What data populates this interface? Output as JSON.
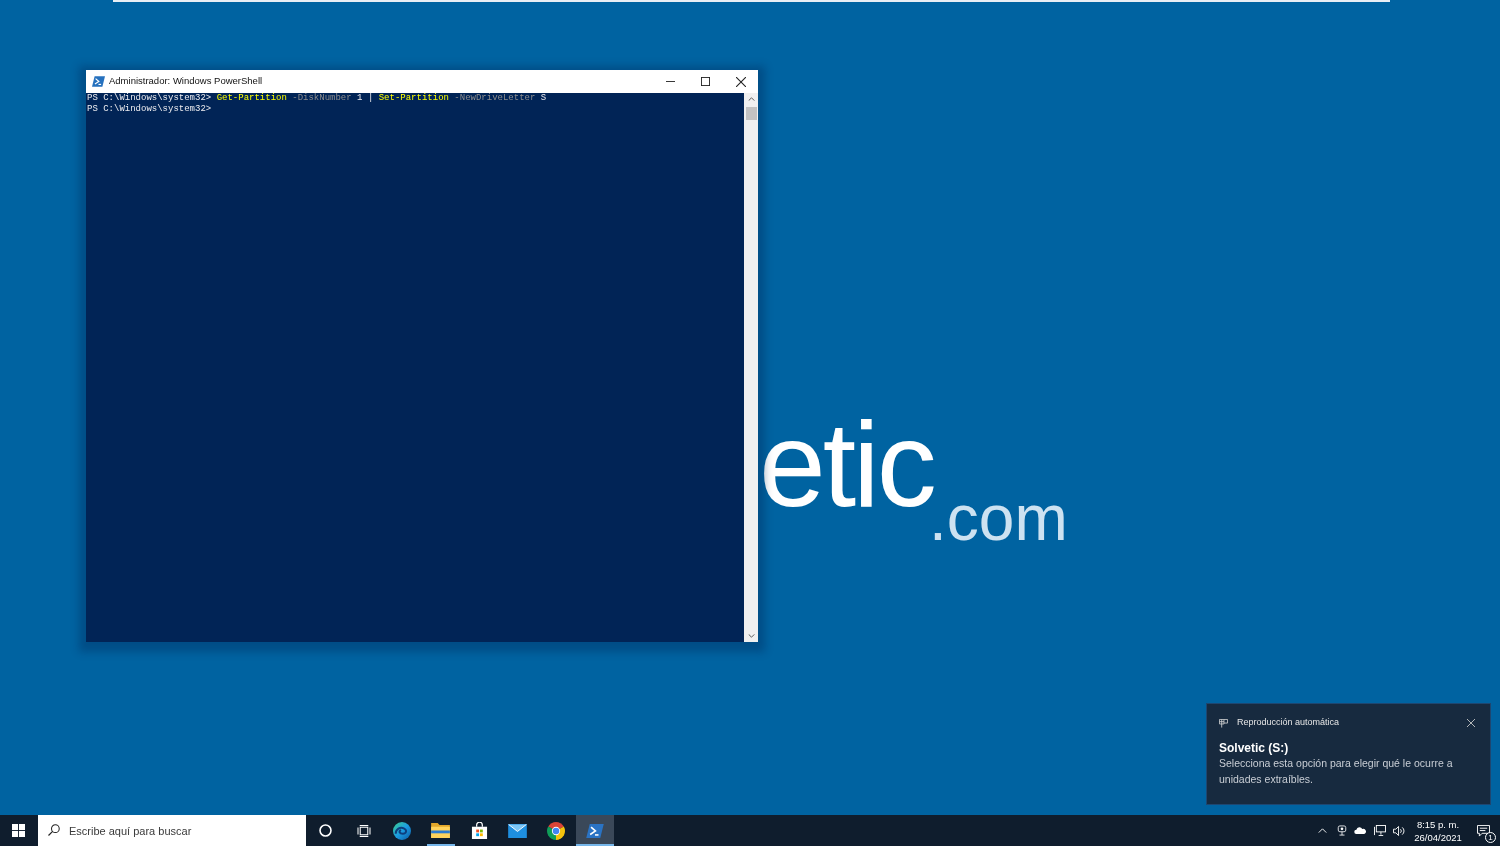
{
  "desktop": {
    "wallpaper_logo": {
      "text": "etic",
      "suffix": ".com"
    }
  },
  "window": {
    "title": "Administrador: Windows PowerShell",
    "console_lines": [
      {
        "segments": [
          {
            "kind": "prompt",
            "text": "PS C:\\Windows\\system32>"
          },
          {
            "kind": "command",
            "text": "Get-Partition"
          },
          {
            "kind": "parameter",
            "text": "-DiskNumber"
          },
          {
            "kind": "argument",
            "text": "1"
          },
          {
            "kind": "operator",
            "text": "|"
          },
          {
            "kind": "command",
            "text": "Set-Partition"
          },
          {
            "kind": "parameter",
            "text": "-NewDriveLetter"
          },
          {
            "kind": "argument",
            "text": "S"
          }
        ]
      },
      {
        "segments": [
          {
            "kind": "prompt",
            "text": "PS C:\\Windows\\system32>"
          }
        ]
      }
    ]
  },
  "notification": {
    "app": "Reproducción automática",
    "title": "Solvetic (S:)",
    "message": "Selecciona esta opción para elegir qué le ocurre a unidades extraíbles."
  },
  "taskbar": {
    "search": {
      "placeholder": "Escribe aquí para buscar"
    },
    "apps": [
      {
        "kind": "edge",
        "running": false,
        "selected": false
      },
      {
        "kind": "explorer",
        "running": true,
        "selected": false
      },
      {
        "kind": "store",
        "running": false,
        "selected": false
      },
      {
        "kind": "mail",
        "running": false,
        "selected": false
      },
      {
        "kind": "chrome",
        "running": false,
        "selected": false
      },
      {
        "kind": "powershell",
        "running": true,
        "selected": true
      }
    ],
    "clock": {
      "time": "8:15 p. m.",
      "date": "26/04/2021"
    },
    "notification_count": "1"
  }
}
